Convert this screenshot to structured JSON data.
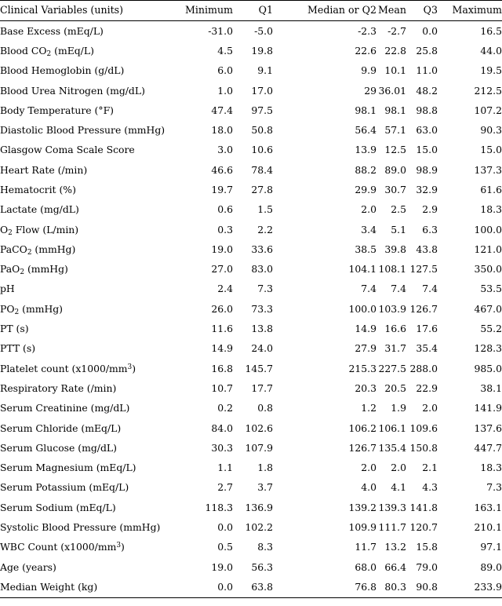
{
  "table": {
    "columns": [
      "Clinical Variables (units)",
      "Minimum",
      "Q1",
      "Median or Q2",
      "Mean",
      "Q3",
      "Maximum"
    ],
    "rows": [
      {
        "variable": "Base Excess (mEq/L)",
        "minimum": "-31.0",
        "q1": "-5.0",
        "median": "-2.3",
        "mean": "-2.7",
        "q3": "0.0",
        "maximum": "16.5"
      },
      {
        "variable": "Blood CO2 (mEq/L)",
        "minimum": "4.5",
        "q1": "19.8",
        "median": "22.6",
        "mean": "22.8",
        "q3": "25.8",
        "maximum": "44.0"
      },
      {
        "variable": "Blood Hemoglobin (g/dL)",
        "minimum": "6.0",
        "q1": "9.1",
        "median": "9.9",
        "mean": "10.1",
        "q3": "11.0",
        "maximum": "19.5"
      },
      {
        "variable": "Blood Urea Nitrogen (mg/dL)",
        "minimum": "1.0",
        "q1": "17.0",
        "median": "29",
        "mean": "36.01",
        "q3": "48.2",
        "maximum": "212.5"
      },
      {
        "variable": "Body Temperature (°F)",
        "minimum": "47.4",
        "q1": "97.5",
        "median": "98.1",
        "mean": "98.1",
        "q3": "98.8",
        "maximum": "107.2"
      },
      {
        "variable": "Diastolic Blood Pressure (mmHg)",
        "minimum": "18.0",
        "q1": "50.8",
        "median": "56.4",
        "mean": "57.1",
        "q3": "63.0",
        "maximum": "90.3"
      },
      {
        "variable": "Glasgow Coma Scale Score",
        "minimum": "3.0",
        "q1": "10.6",
        "median": "13.9",
        "mean": "12.5",
        "q3": "15.0",
        "maximum": "15.0"
      },
      {
        "variable": "Heart Rate (/min)",
        "minimum": "46.6",
        "q1": "78.4",
        "median": "88.2",
        "mean": "89.0",
        "q3": "98.9",
        "maximum": "137.3"
      },
      {
        "variable": "Hematocrit (%)",
        "minimum": "19.7",
        "q1": "27.8",
        "median": "29.9",
        "mean": "30.7",
        "q3": "32.9",
        "maximum": "61.6"
      },
      {
        "variable": "Lactate (mg/dL)",
        "minimum": "0.6",
        "q1": "1.5",
        "median": "2.0",
        "mean": "2.5",
        "q3": "2.9",
        "maximum": "18.3"
      },
      {
        "variable": "O2 Flow (L/min)",
        "minimum": "0.3",
        "q1": "2.2",
        "median": "3.4",
        "mean": "5.1",
        "q3": "6.3",
        "maximum": "100.0"
      },
      {
        "variable": "PaCO2 (mmHg)",
        "minimum": "19.0",
        "q1": "33.6",
        "median": "38.5",
        "mean": "39.8",
        "q3": "43.8",
        "maximum": "121.0"
      },
      {
        "variable": "PaO2 (mmHg)",
        "minimum": "27.0",
        "q1": "83.0",
        "median": "104.1",
        "mean": "108.1",
        "q3": "127.5",
        "maximum": "350.0"
      },
      {
        "variable": "pH",
        "minimum": "2.4",
        "q1": "7.3",
        "median": "7.4",
        "mean": "7.4",
        "q3": "7.4",
        "maximum": "53.5"
      },
      {
        "variable": "PO2 (mmHg)",
        "minimum": "26.0",
        "q1": "73.3",
        "median": "100.0",
        "mean": "103.9",
        "q3": "126.7",
        "maximum": "467.0"
      },
      {
        "variable": "PT (s)",
        "minimum": "11.6",
        "q1": "13.8",
        "median": "14.9",
        "mean": "16.6",
        "q3": "17.6",
        "maximum": "55.2"
      },
      {
        "variable": "PTT (s)",
        "minimum": "14.9",
        "q1": "24.0",
        "median": "27.9",
        "mean": "31.7",
        "q3": "35.4",
        "maximum": "128.3"
      },
      {
        "variable": "Platelet count (x1000/mm3)",
        "minimum": "16.8",
        "q1": "145.7",
        "median": "215.3",
        "mean": "227.5",
        "q3": "288.0",
        "maximum": "985.0"
      },
      {
        "variable": "Respiratory Rate (/min)",
        "minimum": "10.7",
        "q1": "17.7",
        "median": "20.3",
        "mean": "20.5",
        "q3": "22.9",
        "maximum": "38.1"
      },
      {
        "variable": "Serum Creatinine (mg/dL)",
        "minimum": "0.2",
        "q1": "0.8",
        "median": "1.2",
        "mean": "1.9",
        "q3": "2.0",
        "maximum": "141.9"
      },
      {
        "variable": "Serum Chloride (mEq/L)",
        "minimum": "84.0",
        "q1": "102.6",
        "median": "106.2",
        "mean": "106.1",
        "q3": "109.6",
        "maximum": "137.6"
      },
      {
        "variable": "Serum Glucose (mg/dL)",
        "minimum": "30.3",
        "q1": "107.9",
        "median": "126.7",
        "mean": "135.4",
        "q3": "150.8",
        "maximum": "447.7"
      },
      {
        "variable": "Serum Magnesium (mEq/L)",
        "minimum": "1.1",
        "q1": "1.8",
        "median": "2.0",
        "mean": "2.0",
        "q3": "2.1",
        "maximum": "18.3"
      },
      {
        "variable": "Serum Potassium (mEq/L)",
        "minimum": "2.7",
        "q1": "3.7",
        "median": "4.0",
        "mean": "4.1",
        "q3": "4.3",
        "maximum": "7.3"
      },
      {
        "variable": "Serum Sodium (mEq/L)",
        "minimum": "118.3",
        "q1": "136.9",
        "median": "139.2",
        "mean": "139.3",
        "q3": "141.8",
        "maximum": "163.1"
      },
      {
        "variable": "Systolic Blood Pressure (mmHg)",
        "minimum": "0.0",
        "q1": "102.2",
        "median": "109.9",
        "mean": "111.7",
        "q3": "120.7",
        "maximum": "210.1"
      },
      {
        "variable": "WBC Count (x1000/mm3)",
        "minimum": "0.5",
        "q1": "8.3",
        "median": "11.7",
        "mean": "13.2",
        "q3": "15.8",
        "maximum": "97.1"
      },
      {
        "variable": "Age (years)",
        "minimum": "19.0",
        "q1": "56.3",
        "median": "68.0",
        "mean": "66.4",
        "q3": "79.0",
        "maximum": "89.0"
      },
      {
        "variable": "Median Weight (kg)",
        "minimum": "0.0",
        "q1": "63.8",
        "median": "76.8",
        "mean": "80.3",
        "q3": "90.8",
        "maximum": "233.9"
      }
    ]
  },
  "style": {
    "rule_color": "#000000",
    "text_color": "#000000",
    "background": "#ffffff"
  }
}
